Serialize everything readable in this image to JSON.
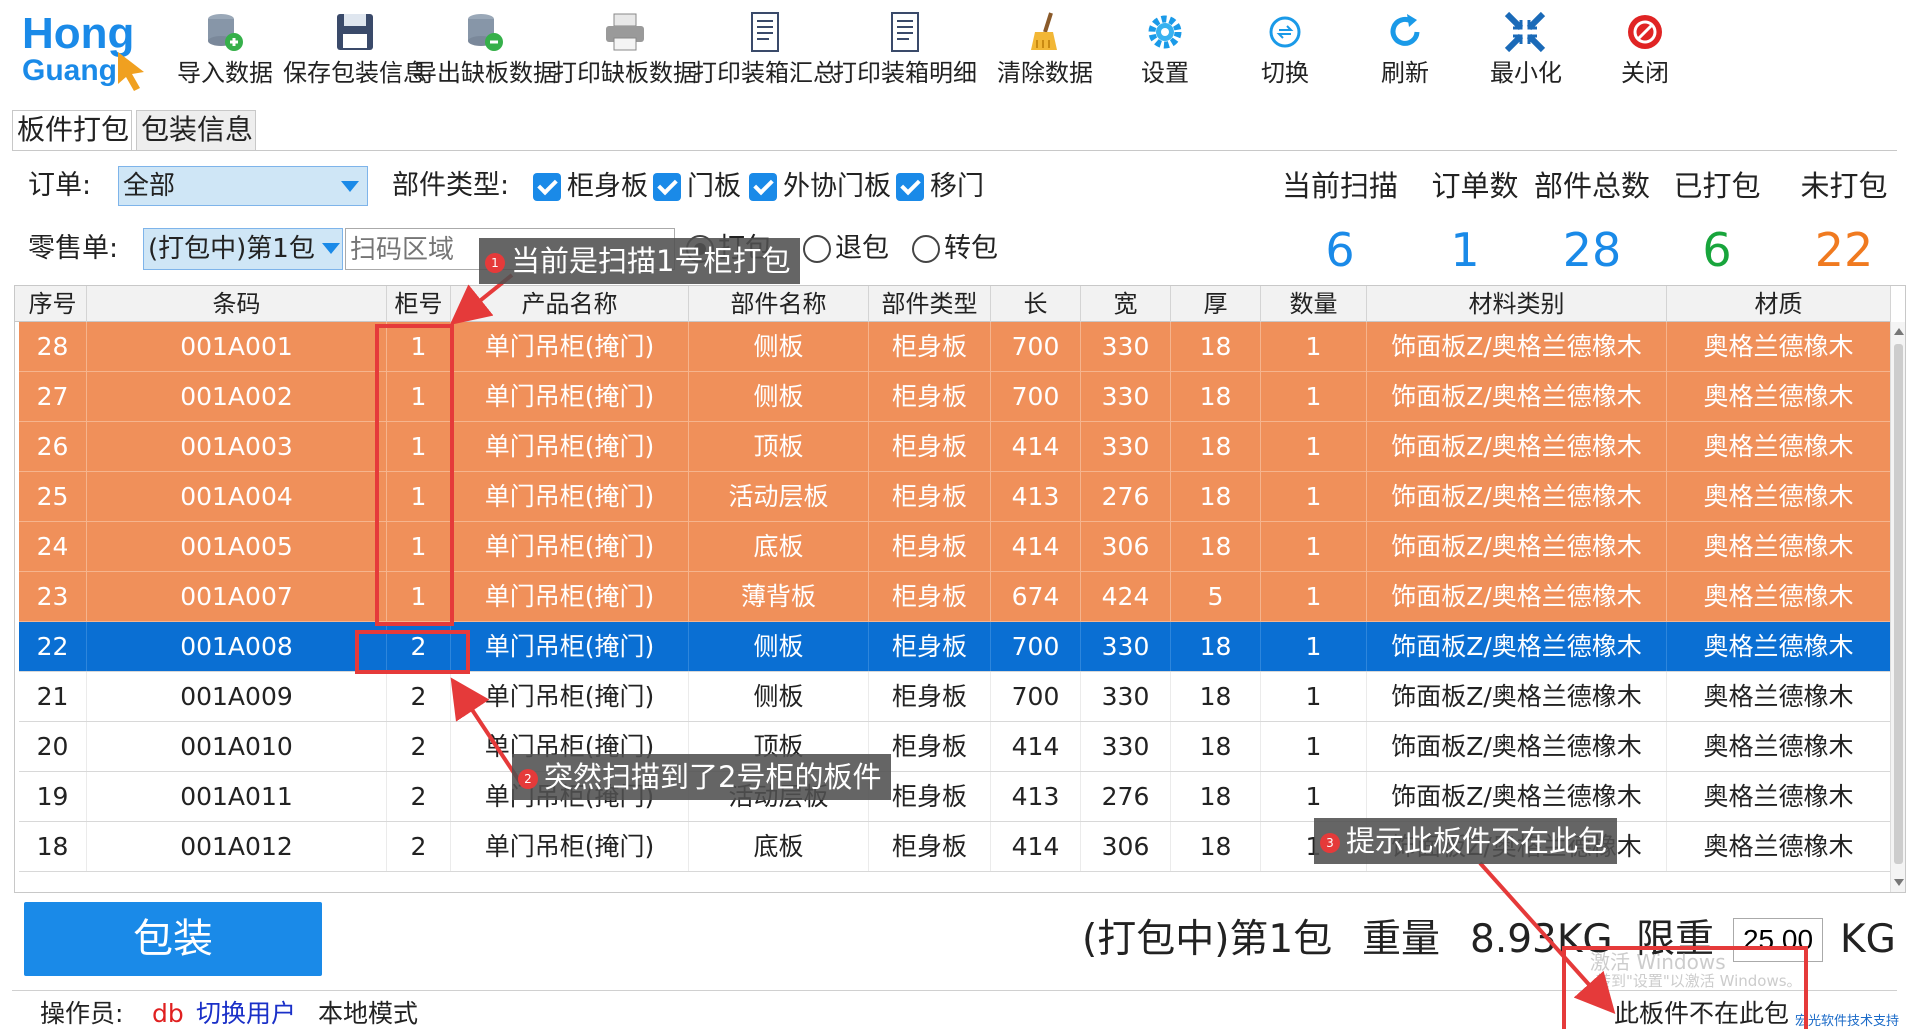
{
  "logo": {
    "line1": "Hong",
    "line2": "Guang"
  },
  "toolbar": [
    {
      "label": "导入数据",
      "icon": "database-import-icon"
    },
    {
      "label": "保存包装信息",
      "icon": "save-icon"
    },
    {
      "label": "导出缺板数据",
      "icon": "database-export-icon"
    },
    {
      "label": "打印缺板数据",
      "icon": "printer-icon"
    },
    {
      "label": "打印装箱汇总",
      "icon": "document-icon"
    },
    {
      "label": "打印装箱明细",
      "icon": "document-icon"
    },
    {
      "label": "清除数据",
      "icon": "broom-icon"
    },
    {
      "label": "设置",
      "icon": "gear-icon"
    },
    {
      "label": "切换",
      "icon": "switch-icon"
    },
    {
      "label": "刷新",
      "icon": "refresh-icon"
    },
    {
      "label": "最小化",
      "icon": "minimize-icon"
    },
    {
      "label": "关闭",
      "icon": "close-icon"
    }
  ],
  "tabs": [
    {
      "label": "板件打包",
      "active": true
    },
    {
      "label": "包装信息",
      "active": false
    }
  ],
  "filters": {
    "order_label": "订单:",
    "order_value": "全部",
    "part_type_label": "部件类型:",
    "part_types": [
      "柜身板",
      "门板",
      "外协门板",
      "移门"
    ],
    "retail_label": "零售单:",
    "retail_value": "(打包中)第1包",
    "scan_placeholder": "扫码区域",
    "modes": [
      {
        "label": "打包",
        "selected": true
      },
      {
        "label": "退包",
        "selected": false
      },
      {
        "label": "转包",
        "selected": false
      }
    ]
  },
  "stats": [
    {
      "label": "当前扫描",
      "value": "6",
      "color": "#1a8ae8"
    },
    {
      "label": "订单数",
      "value": "1",
      "color": "#1a8ae8"
    },
    {
      "label": "部件总数",
      "value": "28",
      "color": "#1a8ae8"
    },
    {
      "label": "已打包",
      "value": "6",
      "color": "#18a53c"
    },
    {
      "label": "未打包",
      "value": "22",
      "color": "#f07a20"
    }
  ],
  "table": {
    "columns": [
      "序号",
      "条码",
      "柜号",
      "产品名称",
      "部件名称",
      "部件类型",
      "长",
      "宽",
      "厚",
      "数量",
      "材料类别",
      "材质"
    ],
    "rows": [
      {
        "state": "packed",
        "cells": [
          "28",
          "001A001",
          "1",
          "单门吊柜(掩门)",
          "侧板",
          "柜身板",
          "700",
          "330",
          "18",
          "1",
          "饰面板Z/奥格兰德橡木",
          "奥格兰德橡木"
        ]
      },
      {
        "state": "packed",
        "cells": [
          "27",
          "001A002",
          "1",
          "单门吊柜(掩门)",
          "侧板",
          "柜身板",
          "700",
          "330",
          "18",
          "1",
          "饰面板Z/奥格兰德橡木",
          "奥格兰德橡木"
        ]
      },
      {
        "state": "packed",
        "cells": [
          "26",
          "001A003",
          "1",
          "单门吊柜(掩门)",
          "顶板",
          "柜身板",
          "414",
          "330",
          "18",
          "1",
          "饰面板Z/奥格兰德橡木",
          "奥格兰德橡木"
        ]
      },
      {
        "state": "packed",
        "cells": [
          "25",
          "001A004",
          "1",
          "单门吊柜(掩门)",
          "活动层板",
          "柜身板",
          "413",
          "276",
          "18",
          "1",
          "饰面板Z/奥格兰德橡木",
          "奥格兰德橡木"
        ]
      },
      {
        "state": "packed",
        "cells": [
          "24",
          "001A005",
          "1",
          "单门吊柜(掩门)",
          "底板",
          "柜身板",
          "414",
          "306",
          "18",
          "1",
          "饰面板Z/奥格兰德橡木",
          "奥格兰德橡木"
        ]
      },
      {
        "state": "packed",
        "cells": [
          "23",
          "001A007",
          "1",
          "单门吊柜(掩门)",
          "薄背板",
          "柜身板",
          "674",
          "424",
          "5",
          "1",
          "饰面板Z/奥格兰德橡木",
          "奥格兰德橡木"
        ]
      },
      {
        "state": "selected",
        "cells": [
          "22",
          "001A008",
          "2",
          "单门吊柜(掩门)",
          "侧板",
          "柜身板",
          "700",
          "330",
          "18",
          "1",
          "饰面板Z/奥格兰德橡木",
          "奥格兰德橡木"
        ]
      },
      {
        "state": "normal",
        "cells": [
          "21",
          "001A009",
          "2",
          "单门吊柜(掩门)",
          "侧板",
          "柜身板",
          "700",
          "330",
          "18",
          "1",
          "饰面板Z/奥格兰德橡木",
          "奥格兰德橡木"
        ]
      },
      {
        "state": "normal",
        "cells": [
          "20",
          "001A010",
          "2",
          "单门吊柜(掩门)",
          "顶板",
          "柜身板",
          "414",
          "330",
          "18",
          "1",
          "饰面板Z/奥格兰德橡木",
          "奥格兰德橡木"
        ]
      },
      {
        "state": "normal",
        "cells": [
          "19",
          "001A011",
          "2",
          "单门吊柜(掩门)",
          "活动层板",
          "柜身板",
          "413",
          "276",
          "18",
          "1",
          "饰面板Z/奥格兰德橡木",
          "奥格兰德橡木"
        ]
      },
      {
        "state": "normal",
        "cells": [
          "18",
          "001A012",
          "2",
          "单门吊柜(掩门)",
          "底板",
          "柜身板",
          "414",
          "306",
          "18",
          "1",
          "饰面板Z/奥格兰德橡木",
          "奥格兰德橡木"
        ]
      }
    ]
  },
  "bottom": {
    "pack_button": "包装",
    "package_name": "(打包中)第1包",
    "weight_label": "重量",
    "weight_value": "8.93KG",
    "limit_label": "限重",
    "limit_value": "25.00",
    "limit_unit": "KG"
  },
  "status": {
    "operator_label": "操作员:",
    "operator": "db",
    "switch_user": "切换用户",
    "mode": "本地模式",
    "message": "此板件不在此包",
    "support": "宏光软件技术支持"
  },
  "watermark": {
    "line1": "激活 Windows",
    "line2": "转到\"设置\"以激活 Windows。"
  },
  "annotations": [
    {
      "num": "1",
      "text": "当前是扫描1号柜打包"
    },
    {
      "num": "2",
      "text": "突然扫描到了2号柜的板件"
    },
    {
      "num": "3",
      "text": "提示此板件不在此包"
    }
  ],
  "colors": {
    "accent": "#1a8ae8",
    "packed_row": "#f0905a",
    "selected_row": "#0a6fd3",
    "annotation_red": "#e53a3a"
  }
}
